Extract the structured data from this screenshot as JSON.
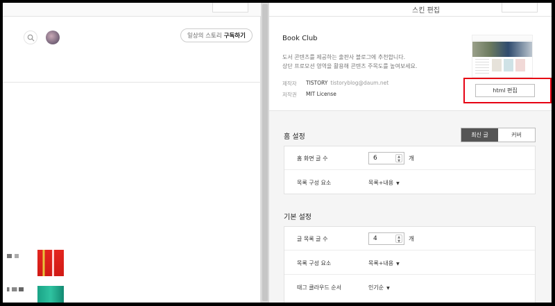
{
  "left_pane": {
    "subscribe_prefix": "일상의 스토리",
    "subscribe_action": "구독하기"
  },
  "right_pane": {
    "header_title": "스킨 편집",
    "skin": {
      "name": "Book Club",
      "description_line1": "도서 콘텐츠를 제공하는 출판사 블로그에 추천합니다.",
      "description_line2": "상단 프로모션 영역을 활용해 콘텐츠 주목도를 높여보세요.",
      "maker_label": "제작자",
      "maker_value": "TISTORY",
      "maker_email": "tistoryblog@daum.net",
      "license_label": "저작권",
      "license_value": "MIT License",
      "html_edit_label": "html 편집"
    },
    "home_settings": {
      "title": "홈 설정",
      "tab_latest": "최신 글",
      "tab_cover": "커버",
      "rows": [
        {
          "label": "홈 화면 글 수",
          "value": "6",
          "unit": "개"
        },
        {
          "label": "목록 구성 요소",
          "value": "목록+내용"
        }
      ]
    },
    "basic_settings": {
      "title": "기본 설정",
      "rows": [
        {
          "label": "글 목록 글 수",
          "value": "4",
          "unit": "개"
        },
        {
          "label": "목록 구성 요소",
          "value": "목록+내용"
        },
        {
          "label": "태그 클라우드 순서",
          "value": "인기순"
        }
      ]
    },
    "colors": {
      "highlight": "#e60012",
      "active_tab": "#555555"
    }
  }
}
